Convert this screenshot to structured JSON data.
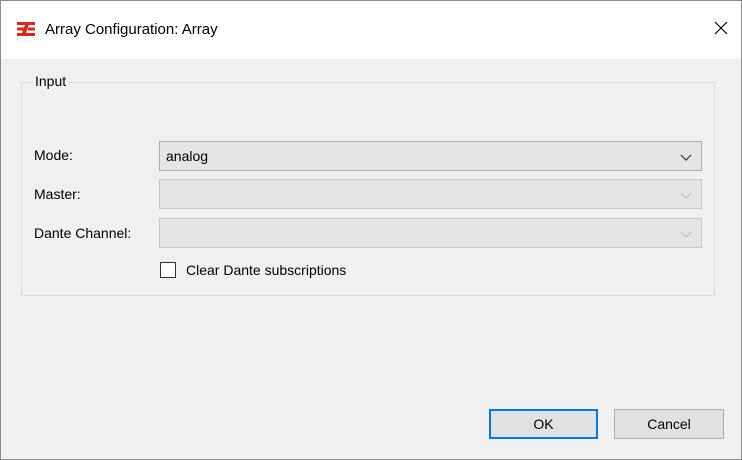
{
  "window": {
    "title": "Array Configuration: Array",
    "app_icon": "array-logo-icon",
    "close_icon": "close-icon"
  },
  "input_group": {
    "legend": "Input",
    "mode": {
      "label": "Mode:",
      "value": "analog",
      "enabled": true
    },
    "master": {
      "label": "Master:",
      "value": "",
      "enabled": false
    },
    "dante_channel": {
      "label": "Dante Channel:",
      "value": "",
      "enabled": false
    },
    "clear_subscriptions": {
      "label": "Clear Dante subscriptions",
      "checked": false
    }
  },
  "buttons": {
    "ok": "OK",
    "cancel": "Cancel"
  },
  "colors": {
    "accent": "#0078d7",
    "logo": "#d52b1e",
    "dialog_bg": "#f0f0f0"
  }
}
